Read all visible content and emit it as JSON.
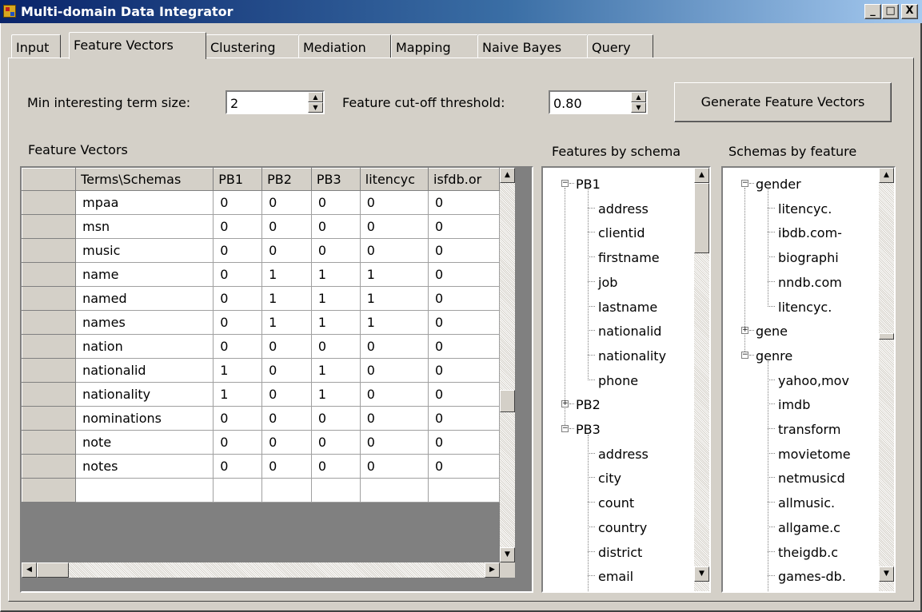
{
  "window": {
    "title": "Multi-domain Data Integrator",
    "minimize": "_",
    "maximize": "□",
    "close": "X"
  },
  "tabs": [
    "Input",
    "Feature Vectors",
    "Clustering",
    "Mediation",
    "Mapping",
    "Naive Bayes",
    "Query"
  ],
  "active_tab": "Feature Vectors",
  "controls": {
    "min_term_label": "Min interesting term size:",
    "min_term_value": "2",
    "cutoff_label": "Feature cut-off threshold:",
    "cutoff_value": "0.80",
    "generate_button": "Generate Feature Vectors"
  },
  "grid": {
    "title": "Feature Vectors",
    "columns": [
      "Terms\\Schemas",
      "PB1",
      "PB2",
      "PB3",
      "litencyc",
      "isfdb.or"
    ],
    "rows": [
      [
        "mpaa",
        "0",
        "0",
        "0",
        "0",
        "0"
      ],
      [
        "msn",
        "0",
        "0",
        "0",
        "0",
        "0"
      ],
      [
        "music",
        "0",
        "0",
        "0",
        "0",
        "0"
      ],
      [
        "name",
        "0",
        "1",
        "1",
        "1",
        "0"
      ],
      [
        "named",
        "0",
        "1",
        "1",
        "1",
        "0"
      ],
      [
        "names",
        "0",
        "1",
        "1",
        "1",
        "0"
      ],
      [
        "nation",
        "0",
        "0",
        "0",
        "0",
        "0"
      ],
      [
        "nationalid",
        "1",
        "0",
        "1",
        "0",
        "0"
      ],
      [
        "nationality",
        "1",
        "0",
        "1",
        "0",
        "0"
      ],
      [
        "nominations",
        "0",
        "0",
        "0",
        "0",
        "0"
      ],
      [
        "note",
        "0",
        "0",
        "0",
        "0",
        "0"
      ],
      [
        "notes",
        "0",
        "0",
        "0",
        "0",
        "0"
      ]
    ]
  },
  "features_by_schema": {
    "title": "Features by schema",
    "items": [
      {
        "text": "PB1",
        "level": 0,
        "toggle": "−"
      },
      {
        "text": "address",
        "level": 1
      },
      {
        "text": "clientid",
        "level": 1
      },
      {
        "text": "firstname",
        "level": 1
      },
      {
        "text": "job",
        "level": 1
      },
      {
        "text": "lastname",
        "level": 1
      },
      {
        "text": "nationalid",
        "level": 1
      },
      {
        "text": "nationality",
        "level": 1
      },
      {
        "text": "phone",
        "level": 1
      },
      {
        "text": "PB2",
        "level": 0,
        "toggle": "+"
      },
      {
        "text": "PB3",
        "level": 0,
        "toggle": "−"
      },
      {
        "text": "address",
        "level": 1
      },
      {
        "text": "city",
        "level": 1
      },
      {
        "text": "count",
        "level": 1
      },
      {
        "text": "country",
        "level": 1
      },
      {
        "text": "district",
        "level": 1
      },
      {
        "text": "email",
        "level": 1
      }
    ]
  },
  "schemas_by_feature": {
    "title": "Schemas by feature",
    "items": [
      {
        "text": "gender",
        "level": 0,
        "toggle": "−"
      },
      {
        "text": "litencyc.",
        "level": 1
      },
      {
        "text": "ibdb.com-",
        "level": 1
      },
      {
        "text": "biographi",
        "level": 1
      },
      {
        "text": "nndb.com",
        "level": 1
      },
      {
        "text": "litencyc.",
        "level": 1
      },
      {
        "text": "gene",
        "level": 0,
        "toggle": "+"
      },
      {
        "text": "genre",
        "level": 0,
        "toggle": "−"
      },
      {
        "text": "yahoo,mov",
        "level": 1
      },
      {
        "text": "imdb",
        "level": 1
      },
      {
        "text": "transform",
        "level": 1
      },
      {
        "text": "movietome",
        "level": 1
      },
      {
        "text": "netmusicd",
        "level": 1
      },
      {
        "text": "allmusic.",
        "level": 1
      },
      {
        "text": "allgame.c",
        "level": 1
      },
      {
        "text": "theigdb.c",
        "level": 1
      },
      {
        "text": "games-db.",
        "level": 1
      }
    ]
  }
}
